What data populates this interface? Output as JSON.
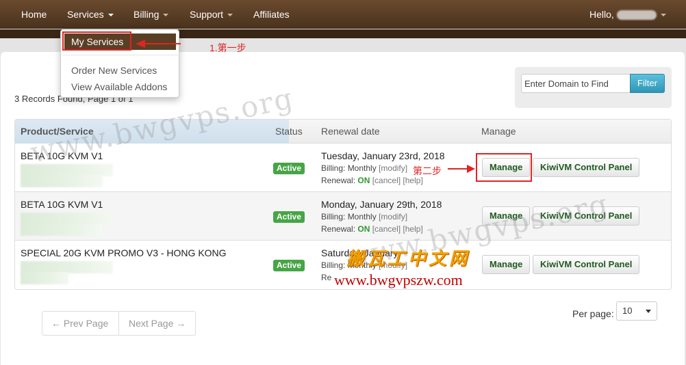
{
  "nav": {
    "home": "Home",
    "services": "Services",
    "billing": "Billing",
    "support": "Support",
    "affiliates": "Affiliates",
    "hello": "Hello,"
  },
  "services_menu": {
    "my_services": "My Services",
    "order_new": "Order New Services",
    "view_addons": "View Available Addons"
  },
  "records_found": "3 Records Found, Page 1 of 1",
  "search": {
    "placeholder": "Enter Domain to Find",
    "filter_label": "Filter"
  },
  "table": {
    "headers": {
      "product": "Product/Service",
      "status": "Status",
      "renewal": "Renewal date",
      "manage": "Manage"
    },
    "rows": [
      {
        "product": "BETA 10G KVM V1",
        "status": "Active",
        "renewal_date": "Tuesday, January 23rd, 2018",
        "billing_label": "Billing: ",
        "billing_value": "Monthly",
        "modify": "[modify]",
        "renewal_label": "Renewal: ",
        "renewal_value": "ON",
        "cancel": "[cancel]",
        "help": "[help]",
        "manage_btn": "Manage",
        "panel_btn": "KiwiVM Control Panel"
      },
      {
        "product": "BETA 10G KVM V1",
        "status": "Active",
        "renewal_date": "Monday, January 29th, 2018",
        "billing_label": "Billing: ",
        "billing_value": "Monthly",
        "modify": "[modify]",
        "renewal_label": "Renewal: ",
        "renewal_value": "ON",
        "cancel": "[cancel]",
        "help": "[help]",
        "manage_btn": "Manage",
        "panel_btn": "KiwiVM Control Panel"
      },
      {
        "product": "SPECIAL 20G KVM PROMO V3 - HONG KONG",
        "status": "Active",
        "renewal_date": "Saturday, January",
        "billing_label": "Billing: ",
        "billing_value": "Monthly",
        "modify": "[modify]",
        "renewal_label": "Re",
        "renewal_value": "",
        "cancel": "",
        "help": "",
        "manage_btn": "Manage",
        "panel_btn": "KiwiVM Control Panel"
      }
    ]
  },
  "pagination": {
    "prev": "← Prev Page",
    "next": "Next Page →",
    "per_page_label": "Per page:",
    "per_page_value": "10"
  },
  "annotations": {
    "step1": "1.第一步",
    "step2": "第二步",
    "accent_color": "#e02424"
  },
  "watermarks": {
    "text1": "www.bwgvps.org",
    "text2": "www.bwgvps.org",
    "cn": "搬瓦工中文网",
    "url": "www.bwgvpszw.com"
  },
  "colors": {
    "nav_bg": "#5b3f25",
    "active_badge": "#46a546",
    "filter_btn": "#2f96b4"
  }
}
